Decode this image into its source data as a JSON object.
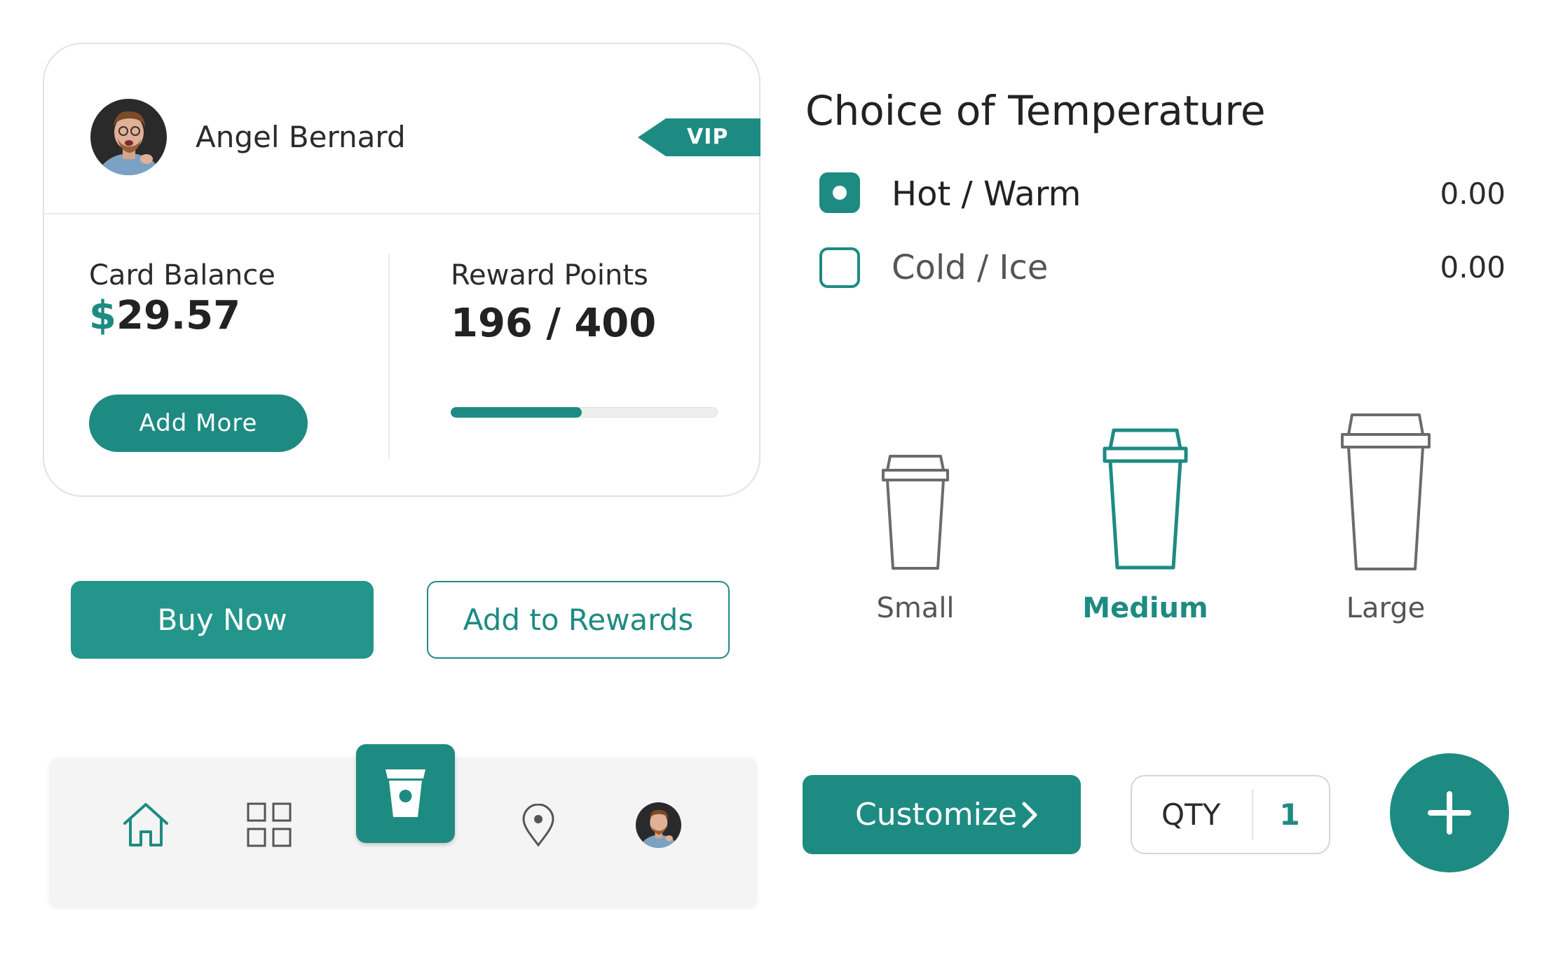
{
  "theme": {
    "accent": "#1e8b82",
    "text": "#222222",
    "muted": "#555555"
  },
  "profile": {
    "name": "Angel Bernard",
    "badge": "VIP",
    "avatar_icon": "user-avatar-photo"
  },
  "balance": {
    "label": "Card Balance",
    "currency_symbol": "$",
    "amount": "29.57",
    "add_more_label": "Add More"
  },
  "rewards": {
    "label": "Reward Points",
    "points_text": "196 / 400",
    "progress_fraction": 0.49
  },
  "actions": {
    "buy_now_label": "Buy Now",
    "add_to_rewards_label": "Add to Rewards"
  },
  "nav": {
    "items": [
      {
        "icon": "home-icon"
      },
      {
        "icon": "grid-icon"
      },
      {
        "icon": "cup-icon",
        "active": true
      },
      {
        "icon": "location-pin-icon"
      },
      {
        "icon": "profile-avatar-icon"
      }
    ]
  },
  "temperature": {
    "title": "Choice of Temperature",
    "options": [
      {
        "label": "Hot / Warm",
        "price": "0.00",
        "selected": true
      },
      {
        "label": "Cold / Ice",
        "price": "0.00",
        "selected": false
      }
    ]
  },
  "sizes": {
    "options": [
      {
        "label": "Small",
        "selected": false
      },
      {
        "label": "Medium",
        "selected": true
      },
      {
        "label": "Large",
        "selected": false
      }
    ]
  },
  "order": {
    "customize_label": "Customize",
    "qty_label": "QTY",
    "qty_value": "1",
    "add_icon": "plus-icon"
  }
}
